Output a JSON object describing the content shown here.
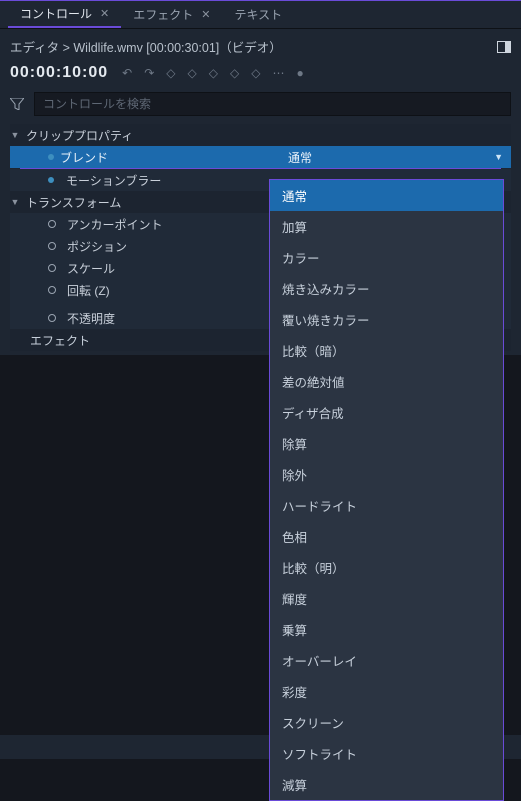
{
  "tabs": [
    {
      "label": "コントロール",
      "closeable": true,
      "active": true
    },
    {
      "label": "エフェクト",
      "closeable": true,
      "active": false
    },
    {
      "label": "テキスト",
      "closeable": false,
      "active": false
    }
  ],
  "breadcrumb": "エディタ > Wildlife.wmv [00:00:30:01]（ビデオ）",
  "timecode": "00:00:10:00",
  "search": {
    "placeholder": "コントロールを検索"
  },
  "tree": {
    "clip_props_label": "クリッププロパティ",
    "blend_label": "ブレンド",
    "blend_value": "通常",
    "motion_blur_label": "モーションブラー",
    "transform_label": "トランスフォーム",
    "anchor_label": "アンカーポイント",
    "position_label": "ポジション",
    "scale_label": "スケール",
    "rotation_label": "回転 (Z)",
    "opacity_label": "不透明度",
    "effects_label": "エフェクト"
  },
  "blend_options": [
    "通常",
    "加算",
    "カラー",
    "焼き込みカラー",
    "覆い焼きカラー",
    "比較（暗）",
    "差の絶対値",
    "ディザ合成",
    "除算",
    "除外",
    "ハードライト",
    "色相",
    "比較（明）",
    "輝度",
    "乗算",
    "オーバーレイ",
    "彩度",
    "スクリーン",
    "ソフトライト",
    "減算"
  ],
  "blend_selected_index": 0
}
